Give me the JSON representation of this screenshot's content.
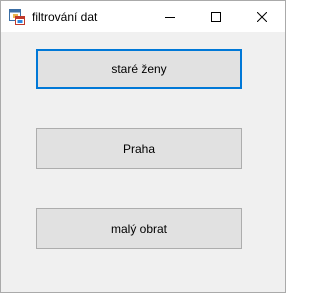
{
  "window": {
    "title": "filtrování dat",
    "app_icon": "winforms-form-icon",
    "controls": {
      "minimize_icon": "minimize-icon",
      "maximize_icon": "maximize-icon",
      "close_icon": "close-icon"
    }
  },
  "buttons": [
    {
      "label": "staré ženy",
      "focused": true
    },
    {
      "label": "Praha",
      "focused": false
    },
    {
      "label": "malý obrat",
      "focused": false
    }
  ],
  "colors": {
    "window_background": "#f0f0f0",
    "titlebar_background": "#ffffff",
    "button_face": "#e1e1e1",
    "button_border": "#adadad",
    "focus_border": "#0078d7"
  }
}
